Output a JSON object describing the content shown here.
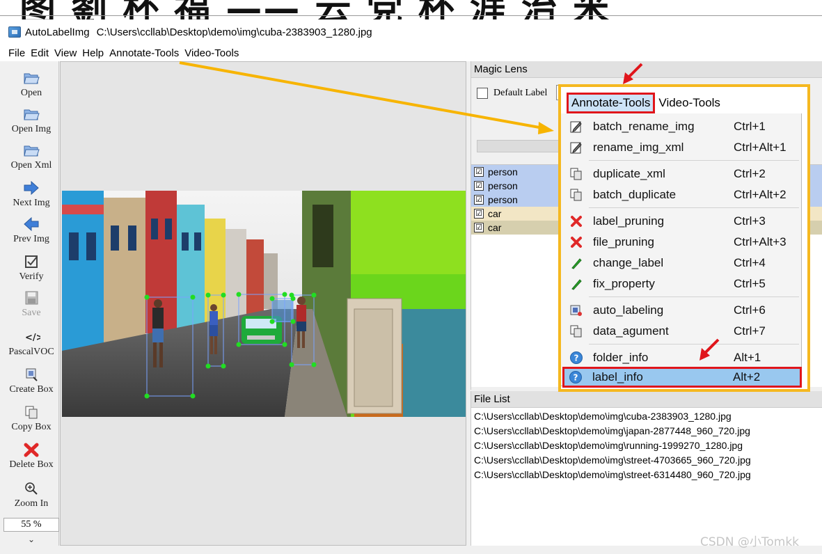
{
  "heading_fragment": "图 劉 杯 福 —— 云 党 杯 涯 治 米",
  "window": {
    "app_name": "AutoLabelImg",
    "file_path": "C:\\Users\\ccllab\\Desktop\\demo\\img\\cuba-2383903_1280.jpg"
  },
  "menubar": [
    "File",
    "Edit",
    "View",
    "Help",
    "Annotate-Tools",
    "Video-Tools"
  ],
  "toolbar": {
    "items": [
      {
        "label": "Open",
        "icon": "folder-open-icon"
      },
      {
        "label": "Open Img",
        "icon": "folder-open-icon"
      },
      {
        "label": "Open Xml",
        "icon": "folder-open-icon"
      },
      {
        "label": "Next Img",
        "icon": "arrow-right-icon"
      },
      {
        "label": "Prev Img",
        "icon": "arrow-left-icon"
      },
      {
        "label": "Verify",
        "icon": "checkbox-icon"
      },
      {
        "label": "Save",
        "icon": "save-icon"
      },
      {
        "label": "PascalVOC",
        "icon": "code-tag-icon"
      },
      {
        "label": "Create Box",
        "icon": "create-box-icon"
      },
      {
        "label": "Copy Box",
        "icon": "copy-icon"
      },
      {
        "label": "Delete Box",
        "icon": "delete-x-icon"
      },
      {
        "label": "Zoom In",
        "icon": "zoom-in-icon"
      }
    ],
    "zoom_value": "55 %",
    "more": "⌄"
  },
  "magic_lens": {
    "title": "Magic Lens",
    "default_label": "Default Label"
  },
  "labels": [
    {
      "text": "person",
      "checked": "☑"
    },
    {
      "text": "person",
      "checked": "☑"
    },
    {
      "text": "person",
      "checked": "☑"
    },
    {
      "text": "car",
      "checked": "☑"
    },
    {
      "text": "car",
      "checked": "☑"
    }
  ],
  "file_list": {
    "title": "File List",
    "files": [
      "C:\\Users\\ccllab\\Desktop\\demo\\img\\cuba-2383903_1280.jpg",
      "C:\\Users\\ccllab\\Desktop\\demo\\img\\japan-2877448_960_720.jpg",
      "C:\\Users\\ccllab\\Desktop\\demo\\img\\running-1999270_1280.jpg",
      "C:\\Users\\ccllab\\Desktop\\demo\\img\\street-4703665_960_720.jpg",
      "C:\\Users\\ccllab\\Desktop\\demo\\img\\street-6314480_960_720.jpg"
    ]
  },
  "dropdown": {
    "tab_active": "Annotate-Tools",
    "tab_other": "Video-Tools",
    "items": [
      {
        "label": "batch_rename_img",
        "shortcut": "Ctrl+1",
        "icon": "pencil-note-icon"
      },
      {
        "label": "rename_img_xml",
        "shortcut": "Ctrl+Alt+1",
        "icon": "pencil-note-icon"
      },
      {
        "label": "duplicate_xml",
        "shortcut": "Ctrl+2",
        "icon": "copy-icon"
      },
      {
        "label": "batch_duplicate",
        "shortcut": "Ctrl+Alt+2",
        "icon": "copy-icon"
      },
      {
        "label": "label_pruning",
        "shortcut": "Ctrl+3",
        "icon": "red-x-icon"
      },
      {
        "label": "file_pruning",
        "shortcut": "Ctrl+Alt+3",
        "icon": "red-x-icon"
      },
      {
        "label": "change_label",
        "shortcut": "Ctrl+4",
        "icon": "green-pen-icon"
      },
      {
        "label": "fix_property",
        "shortcut": "Ctrl+5",
        "icon": "green-pen-icon"
      },
      {
        "label": "auto_labeling",
        "shortcut": "Ctrl+6",
        "icon": "auto-label-icon"
      },
      {
        "label": "data_agument",
        "shortcut": "Ctrl+7",
        "icon": "copy-icon"
      },
      {
        "label": "folder_info",
        "shortcut": "Alt+1",
        "icon": "help-circle-icon"
      },
      {
        "label": "label_info",
        "shortcut": "Alt+2",
        "icon": "help-circle-icon"
      }
    ]
  },
  "watermark": "CSDN @小Tomkk",
  "colors": {
    "highlight_red": "#e0151b",
    "frame_yellow": "#f5b820",
    "arrow_orange": "#f7b400",
    "selected_blue": "#99c8ef",
    "bbox_green": "#22dd22"
  }
}
